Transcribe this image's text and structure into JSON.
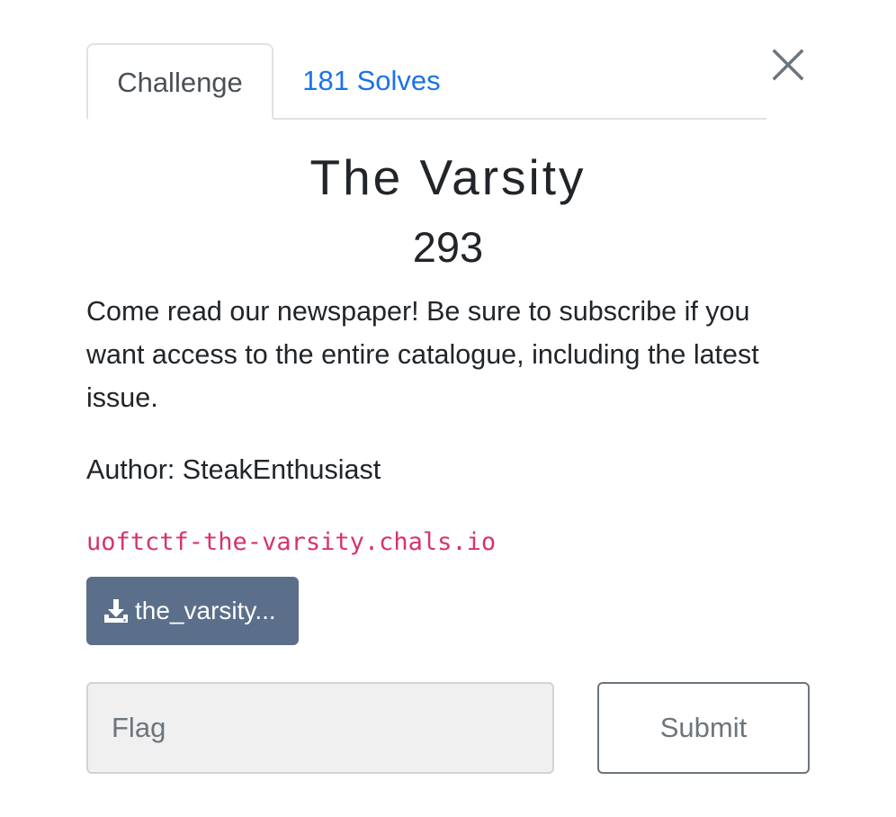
{
  "tabs": {
    "challenge_label": "Challenge",
    "solves_label": "181 Solves"
  },
  "challenge": {
    "name": "The Varsity",
    "points": "293",
    "description": "Come read our newspaper! Be sure to subscribe if you want access to the entire catalogue, including the latest issue.",
    "author": "Author: SteakEnthusiast",
    "connection_info": "uoftctf-the-varsity.chals.io",
    "file_label": "the_varsity..."
  },
  "form": {
    "flag_placeholder": "Flag",
    "flag_value": "",
    "submit_label": "Submit"
  },
  "colors": {
    "link_blue": "#1a73e8",
    "file_button_bg": "#5b6f8b",
    "connection_pink": "#d6336c"
  },
  "icons": {
    "close": "close-icon",
    "download": "download-icon"
  }
}
